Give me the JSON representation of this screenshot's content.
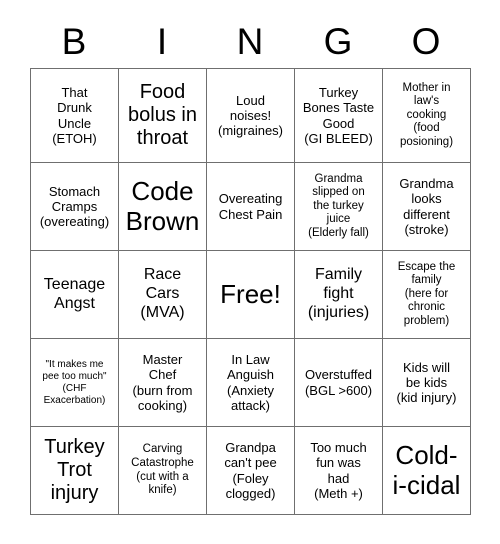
{
  "card": {
    "title": "Bingo Card",
    "header_letters": [
      "B",
      "I",
      "N",
      "G",
      "O"
    ],
    "grid_size": "5x5",
    "colors": {
      "background": "#ffffff",
      "text": "#000000",
      "grid_line": "#6f6f6f"
    },
    "cells": [
      [
        {
          "text": "That\nDrunk\nUncle\n(ETOH)",
          "size": "m"
        },
        {
          "text": "Food\nbolus in\nthroat",
          "size": "xl"
        },
        {
          "text": "Loud\nnoises!\n(migraines)",
          "size": "m"
        },
        {
          "text": "Turkey\nBones Taste\nGood\n(GI BLEED)",
          "size": "m"
        },
        {
          "text": "Mother in\nlaw's\ncooking\n(food\nposioning)",
          "size": "s"
        }
      ],
      [
        {
          "text": "Stomach\nCramps\n(overeating)",
          "size": "m"
        },
        {
          "text": "Code\nBrown",
          "size": "xxl"
        },
        {
          "text": "Overeating\nChest Pain",
          "size": "m"
        },
        {
          "text": "Grandma\nslipped on\nthe turkey\njuice\n(Elderly fall)",
          "size": "s"
        },
        {
          "text": "Grandma\nlooks\ndifferent\n(stroke)",
          "size": "m"
        }
      ],
      [
        {
          "text": "Teenage\nAngst",
          "size": "l"
        },
        {
          "text": "Race\nCars\n(MVA)",
          "size": "l"
        },
        {
          "text": "Free!",
          "size": "xxl"
        },
        {
          "text": "Family\nfight\n(injuries)",
          "size": "l"
        },
        {
          "text": "Escape the\nfamily\n(here for\nchronic\nproblem)",
          "size": "s"
        }
      ],
      [
        {
          "text": "\"It makes me\npee too much\"\n(CHF\nExacerbation)",
          "size": "xs"
        },
        {
          "text": "Master\nChef\n(burn from\ncooking)",
          "size": "m"
        },
        {
          "text": "In Law\nAnguish\n(Anxiety\nattack)",
          "size": "m"
        },
        {
          "text": "Overstuffed\n(BGL >600)",
          "size": "m"
        },
        {
          "text": "Kids will\nbe kids\n(kid injury)",
          "size": "m"
        }
      ],
      [
        {
          "text": "Turkey\nTrot\ninjury",
          "size": "xl"
        },
        {
          "text": "Carving\nCatastrophe\n(cut with a\nknife)",
          "size": "s"
        },
        {
          "text": "Grandpa\ncan't pee\n(Foley\nclogged)",
          "size": "m"
        },
        {
          "text": "Too much\nfun was\nhad\n(Meth +)",
          "size": "m"
        },
        {
          "text": "Cold-\ni-cidal",
          "size": "xxl"
        }
      ]
    ]
  }
}
